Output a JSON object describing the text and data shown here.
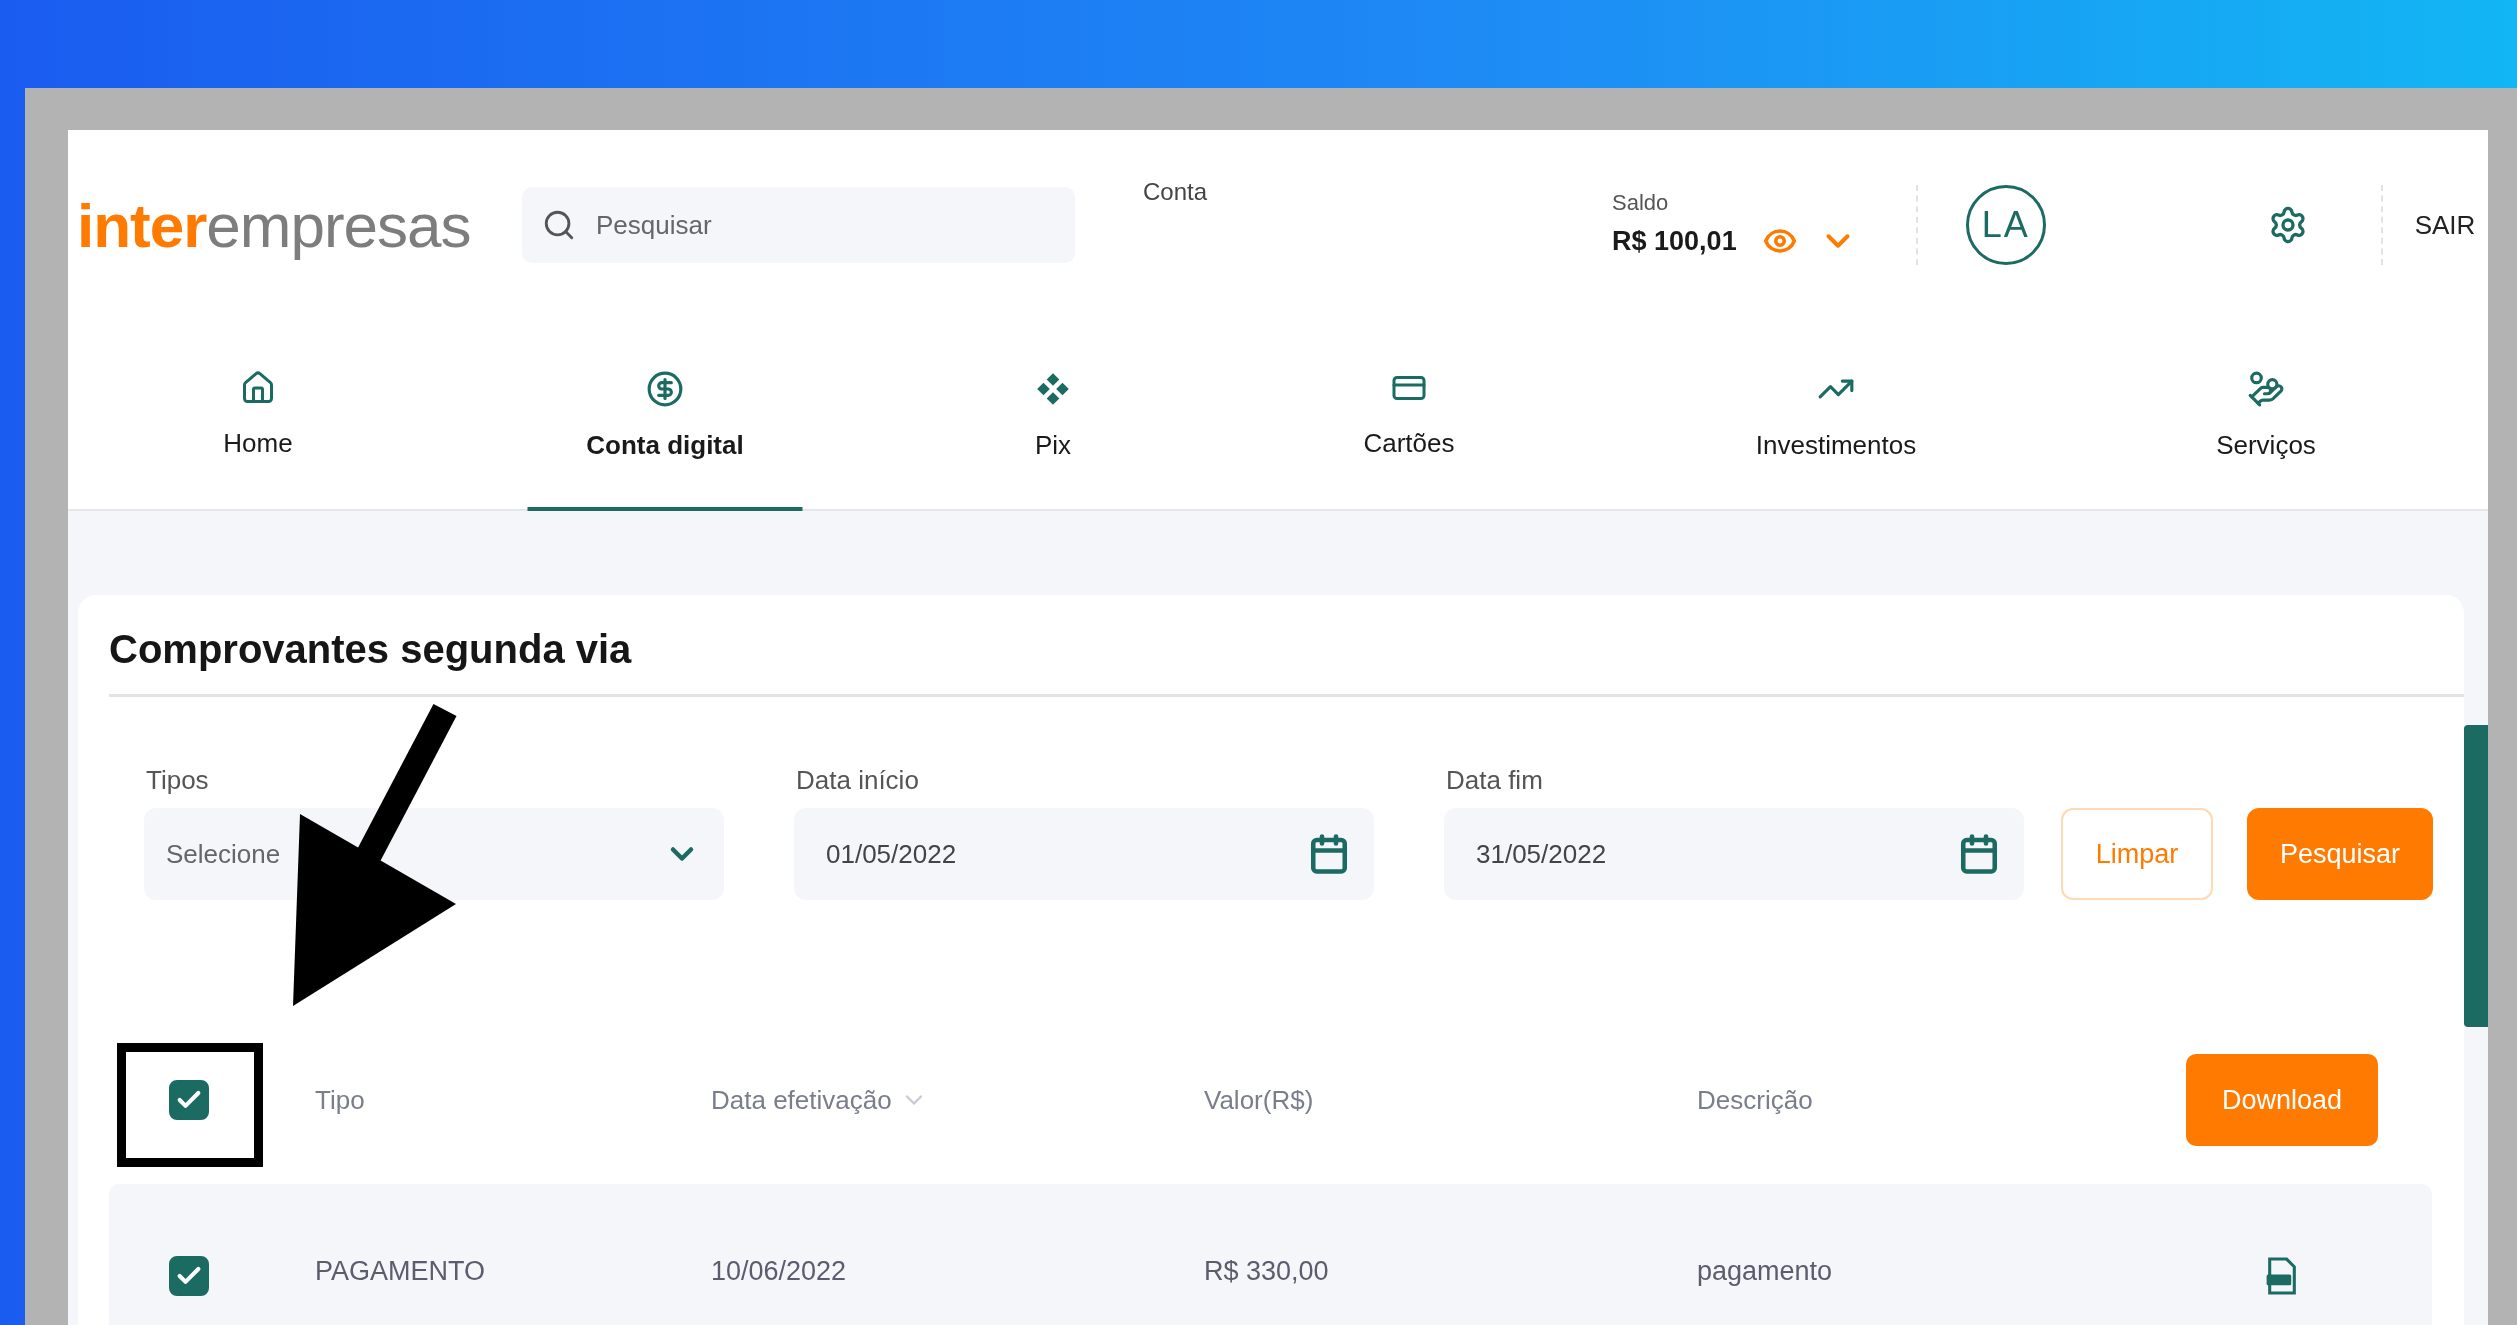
{
  "header": {
    "logo": {
      "part_1": "inter",
      "part_2": "empresas"
    },
    "search": {
      "placeholder": "Pesquisar"
    },
    "account_label": "Conta",
    "balance": {
      "label": "Saldo",
      "value": "R$ 100,01"
    },
    "avatar": "LA",
    "logout": "SAIR"
  },
  "nav": [
    {
      "label": "Home",
      "selected": false
    },
    {
      "label": "Conta digital",
      "selected": true
    },
    {
      "label": "Pix",
      "selected": false
    },
    {
      "label": "Cartões",
      "selected": false
    },
    {
      "label": "Investimentos",
      "selected": false
    },
    {
      "label": "Serviços",
      "selected": false
    }
  ],
  "card": {
    "title": "Comprovantes segunda via",
    "filters": [
      {
        "kind": "select",
        "label": "Tipos",
        "placeholder": "Selecione"
      },
      {
        "kind": "date",
        "label": "Data início",
        "value": "01/05/2022"
      },
      {
        "kind": "date",
        "label": "Data fim",
        "value": "31/05/2022"
      }
    ],
    "buttons": [
      {
        "kind": "outline",
        "label": "Limpar"
      },
      {
        "kind": "primary",
        "label": "Pesquisar"
      }
    ],
    "table": {
      "select_all": {
        "checked": true
      },
      "columns": [
        {
          "label": "Tipo",
          "sortable": false
        },
        {
          "label": "Data efetivação",
          "sortable": true
        },
        {
          "label": "Valor(R$)",
          "sortable": false
        },
        {
          "label": "Descrição",
          "sortable": false
        }
      ],
      "download_button": "Download",
      "rows": [
        {
          "checked": true,
          "cells": [
            "PAGAMENTO",
            "10/06/2022",
            "R$ 330,00",
            "pagamento"
          ]
        }
      ]
    }
  }
}
